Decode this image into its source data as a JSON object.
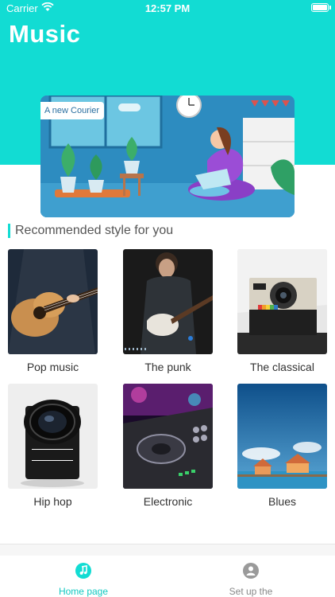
{
  "status_bar": {
    "carrier": "Carrier",
    "time": "12:57 PM"
  },
  "header": {
    "title": "Music"
  },
  "banner": {
    "label": "A new Courier"
  },
  "section": {
    "title": "Recommended style for you"
  },
  "styles": [
    {
      "label": "Pop music",
      "icon": "acoustic-guitar-photo"
    },
    {
      "label": "The punk",
      "icon": "electric-guitar-player-photo"
    },
    {
      "label": "The classical",
      "icon": "instant-camera-photo"
    },
    {
      "label": "Hip hop",
      "icon": "camera-lens-photo"
    },
    {
      "label": "Electronic",
      "icon": "dj-controller-photo"
    },
    {
      "label": "Blues",
      "icon": "pier-houses-photo"
    }
  ],
  "tab_bar": {
    "items": [
      {
        "label": "Home page",
        "icon": "music-note-icon",
        "active": true
      },
      {
        "label": "Set up the",
        "icon": "user-icon",
        "active": false
      }
    ]
  },
  "colors": {
    "accent": "#12dcd3",
    "accent_text": "#12c9c1"
  }
}
